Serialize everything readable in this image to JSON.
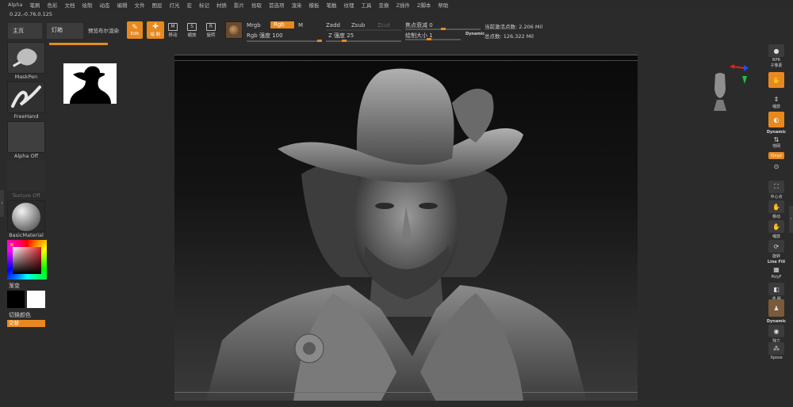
{
  "menu": [
    "Alpha",
    "笔刷",
    "色彩",
    "文档",
    "绘制",
    "动态",
    "编辑",
    "文件",
    "图层",
    "灯光",
    "宏",
    "标记",
    "材质",
    "影片",
    "拾取",
    "首选项",
    "渲染",
    "模板",
    "笔触",
    "纹理",
    "工具",
    "变换",
    "Z插件",
    "Z脚本",
    "帮助"
  ],
  "coords": "0.22,-0.76,0.125",
  "toolbar": {
    "home_tab": "主页",
    "lightbox_tab": "灯箱",
    "bpr_tab": "预览布尔渲染",
    "edit_label": "Edit",
    "draw_label": "绘 制",
    "move_label": "移动",
    "scale_label": "缩放",
    "rotate_label": "旋转",
    "mrgb": "Mrgb",
    "rgb": "Rgb",
    "m": "M",
    "rgb_intensity": "Rgb 强度 100",
    "zadd": "Zadd",
    "zsub": "Zsub",
    "zcut": "Zcut",
    "z_intensity": "Z 强度 25",
    "focal_shift": "焦点衰减 0",
    "draw_size": "绘制大小 1",
    "dynamic": "Dynamic",
    "active_points": "当前激活点数: 2.206 Mil",
    "total_points": "总点数: 126.322 Mil"
  },
  "left": {
    "brush_name": "MaskPen",
    "stroke_name": "FreeHand",
    "alpha_name": "Alpha Off",
    "texture_name": "Texture Off",
    "material_name": "BasicMaterial",
    "gradient_label": "渐变",
    "switch_color": "切换颜色",
    "alternate": "交替"
  },
  "right": {
    "bpr": "BPR",
    "subtool": "子像素",
    "scroll": "滚动",
    "zoom": "缩放",
    "actual": "实际",
    "aahalf": "抗锯齿",
    "dynamic": "Dynamic",
    "persp": "透视",
    "floor": "地网",
    "local": "局部",
    "xyz": "Qxyz",
    "frame": "中心点",
    "move": "移动",
    "scale": "缩放",
    "rotate": "旋转",
    "linefill": "Line Fill",
    "polyf": "PolyF",
    "transp": "透 明",
    "ghost": "Ghost",
    "dynamic2": "Dynamic",
    "solo": "独立",
    "xpose": "Xpose"
  },
  "colors": {
    "accent": "#e8891f",
    "bg": "#2b2b2b",
    "panel": "#3c3c3c"
  }
}
